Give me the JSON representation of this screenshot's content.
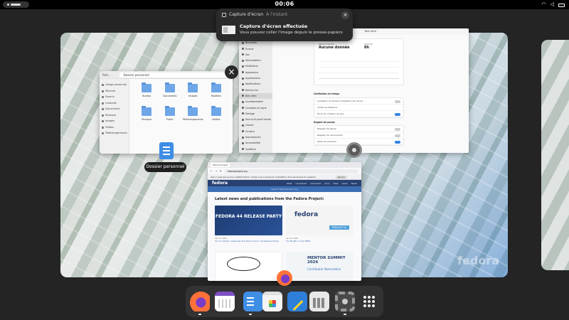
{
  "topbar": {
    "clock": "00:06",
    "tray": [
      "wifi-icon",
      "volume-icon",
      "battery-icon"
    ]
  },
  "notification": {
    "app_name": "Capture d'écran",
    "time": "À l'instant",
    "title": "Capture d'écran effectuée",
    "body": "Vous pouvez coller l'image depuis le presse-papiers"
  },
  "files_window": {
    "title": "Fich...",
    "path": "Dossier personnel",
    "sidebar": [
      "Usage personnel",
      "Récents",
      "Favoris",
      "Corbeille",
      "Documents",
      "Musique",
      "Images",
      "Vidéos",
      "Téléchargements"
    ],
    "folders": [
      "Bureau",
      "Documents",
      "Images",
      "Modèles",
      "Musique",
      "Public",
      "Téléchargements",
      "Vidéos"
    ],
    "label": "Dossier personnel"
  },
  "settings_window": {
    "title": "Bien-être",
    "sidebar": [
      "Réseau",
      "Bluetooth",
      "Écrans",
      "Son",
      "Alimentation",
      "Multitâche",
      "Apparence",
      "Applications",
      "Notifications",
      "Recherche",
      "Bien-être",
      "Confidentialité",
      "Comptes en ligne",
      "Partage",
      "Souris et pavé tactile",
      "Clavier",
      "Couleur",
      "Imprimantes",
      "Accessibilité",
      "Système"
    ],
    "selected": "Bien-être",
    "stat1_key": "Temps d'écran",
    "stat1_val": "Aucune donnée",
    "stat2_key": "Objectif",
    "stat2_val": "8h",
    "section1": "Limitation du temps",
    "rows1": [
      "Limitation du temps d'utilisation de l'écran",
      "Limite quotidienne",
      "Écran en niveaux de gris"
    ],
    "section2": "Rappel de pause",
    "rows2": [
      "Rappels de pause",
      "Rappels de mouvement",
      "Mode de sommeil"
    ]
  },
  "browser_window": {
    "tab": "Fedora Project",
    "url": "fedoraproject.org",
    "notice": "Vous n'avez pas encore installé Fedora ? Aidez-nous à améliorer l'installation et le lancement du système.",
    "notice_button": "Ignorer",
    "site_logo": "fedora",
    "nav_links": [
      "Start",
      "Contribute",
      "Download",
      "Docs",
      "Help",
      "Learn",
      "News"
    ],
    "search_placeholder": "Search fedoraproject.org",
    "heading": "Latest news and publications from the Fedora Project:",
    "posts": [
      {
        "image_text": "FEDORA 44 RELEASE PARTY",
        "date": "Apr 21, 2026",
        "title": "You're Invited: Celebrate the Fedora Linux 44 Release Party!"
      },
      {
        "image_text": "fedora",
        "badge": "PODCAST 54",
        "date": "Apr 20, 2026",
        "title": "54: Bluefin in the BIRD"
      },
      {
        "image_text": "",
        "date": "",
        "title": ""
      },
      {
        "image_text": "MENTOR SUMMIT 2026",
        "sub": "Contributor Nomination",
        "date": "",
        "title": ""
      }
    ]
  },
  "dock": [
    "Firefox",
    "Agenda",
    "Fichiers",
    "Logiciels",
    "Éditeur de texte",
    "Calculatrice",
    "Paramètres",
    "Afficher les applications"
  ],
  "wallpaper_watermark": "fedora"
}
